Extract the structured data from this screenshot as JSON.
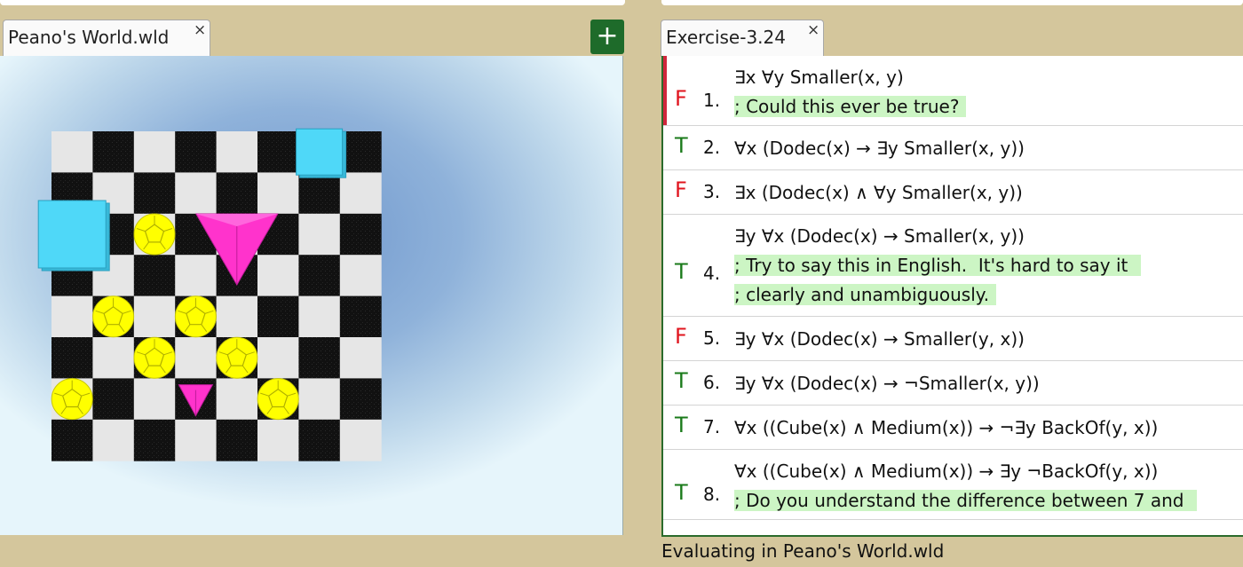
{
  "left_tab": {
    "title": "Peano's World.wld",
    "close": "×"
  },
  "add_button": {
    "label": "+"
  },
  "right_tab": {
    "title": "Exercise-3.24",
    "close": "×"
  },
  "colors": {
    "true": "#1a7a1a",
    "false": "#e0141e",
    "comment_bg": "#ccf5c4",
    "cube": "#4fd8f8",
    "dodec": "#ffff00",
    "tet": "#ff33cc",
    "frame": "#d4c69c",
    "accent": "#1e6b2a"
  },
  "world_objects": [
    {
      "shape": "cube",
      "size": "small",
      "col": 6,
      "row": 0
    },
    {
      "shape": "cube",
      "size": "medium",
      "col": 0,
      "row": 2
    },
    {
      "shape": "dodec",
      "size": "small",
      "col": 2,
      "row": 2
    },
    {
      "shape": "tet",
      "size": "large",
      "col": 4,
      "row": 2
    },
    {
      "shape": "dodec",
      "size": "small",
      "col": 1,
      "row": 4
    },
    {
      "shape": "dodec",
      "size": "small",
      "col": 3,
      "row": 4
    },
    {
      "shape": "dodec",
      "size": "small",
      "col": 2,
      "row": 5
    },
    {
      "shape": "dodec",
      "size": "small",
      "col": 4,
      "row": 5
    },
    {
      "shape": "dodec",
      "size": "small",
      "col": 0,
      "row": 6
    },
    {
      "shape": "tet",
      "size": "small",
      "col": 3,
      "row": 6
    },
    {
      "shape": "dodec",
      "size": "small",
      "col": 5,
      "row": 6
    }
  ],
  "sentences": [
    {
      "value": "F",
      "number": "1.",
      "formula": "∃x ∀y Smaller(x, y)",
      "comments": [
        "; Could this ever be true?"
      ]
    },
    {
      "value": "T",
      "number": "2.",
      "formula": "∀x (Dodec(x) → ∃y Smaller(x, y))",
      "comments": []
    },
    {
      "value": "F",
      "number": "3.",
      "formula": "∃x (Dodec(x) ∧ ∀y Smaller(x, y))",
      "comments": []
    },
    {
      "value": "T",
      "number": "4.",
      "formula": "∃y ∀x (Dodec(x) → Smaller(x, y))",
      "comments": [
        "; Try to say this in English.  It's hard to say it ",
        "; clearly and unambiguously."
      ]
    },
    {
      "value": "F",
      "number": "5.",
      "formula": "∃y ∀x (Dodec(x) → Smaller(y, x))",
      "comments": []
    },
    {
      "value": "T",
      "number": "6.",
      "formula": "∃y ∀x (Dodec(x) → ¬Smaller(x, y))",
      "comments": []
    },
    {
      "value": "T",
      "number": "7.",
      "formula": "∀x ((Cube(x) ∧ Medium(x)) → ¬∃y BackOf(y, x))",
      "comments": []
    },
    {
      "value": "T",
      "number": "8.",
      "formula": "∀x ((Cube(x) ∧ Medium(x)) → ∃y ¬BackOf(y, x))",
      "comments": [
        "; Do you understand the difference between 7 and "
      ]
    }
  ],
  "status": {
    "text": "Evaluating in Peano's World.wld"
  }
}
